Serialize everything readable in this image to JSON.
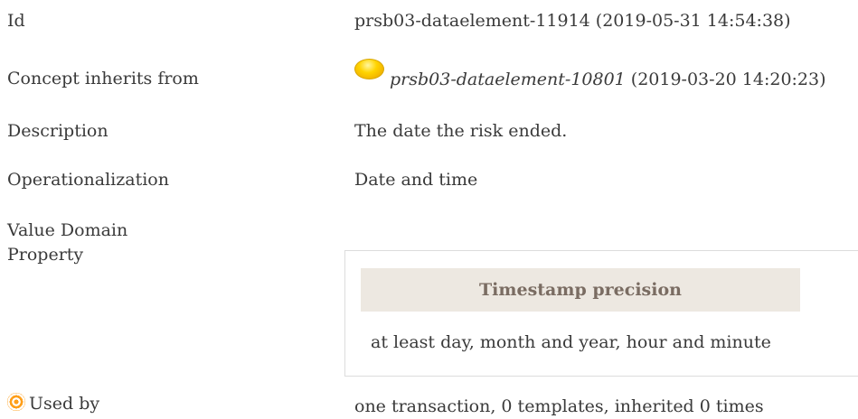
{
  "fields": {
    "id": {
      "label": "Id",
      "value": "prsb03-dataelement-11914 (2019-05-31 14:54:38)"
    },
    "concept_inherits_from": {
      "label": "Concept inherits from",
      "link": "prsb03-dataelement-10801",
      "date": "(2019-03-20 14:20:23)",
      "status_icon": "status-dot-yellow-icon"
    },
    "description": {
      "label": "Description",
      "value": "The date the risk ended."
    },
    "operationalization": {
      "label": "Operationalization",
      "value": "Date and time"
    },
    "value_domain": {
      "label": "Value Domain"
    },
    "property": {
      "label": "Property",
      "header": "Timestamp precision",
      "value": "at least day, month and year, hour and minute"
    },
    "used_by": {
      "label": "Used by",
      "value": "one transaction, 0 templates, inherited 0 times",
      "icon": "target-icon"
    }
  },
  "colors": {
    "text": "#3a3a3a",
    "property_header_bg": "#ede8e1",
    "property_header_text": "#7a6c62",
    "status_dot": "#ffd400",
    "target_icon": "#ff9f1a"
  }
}
